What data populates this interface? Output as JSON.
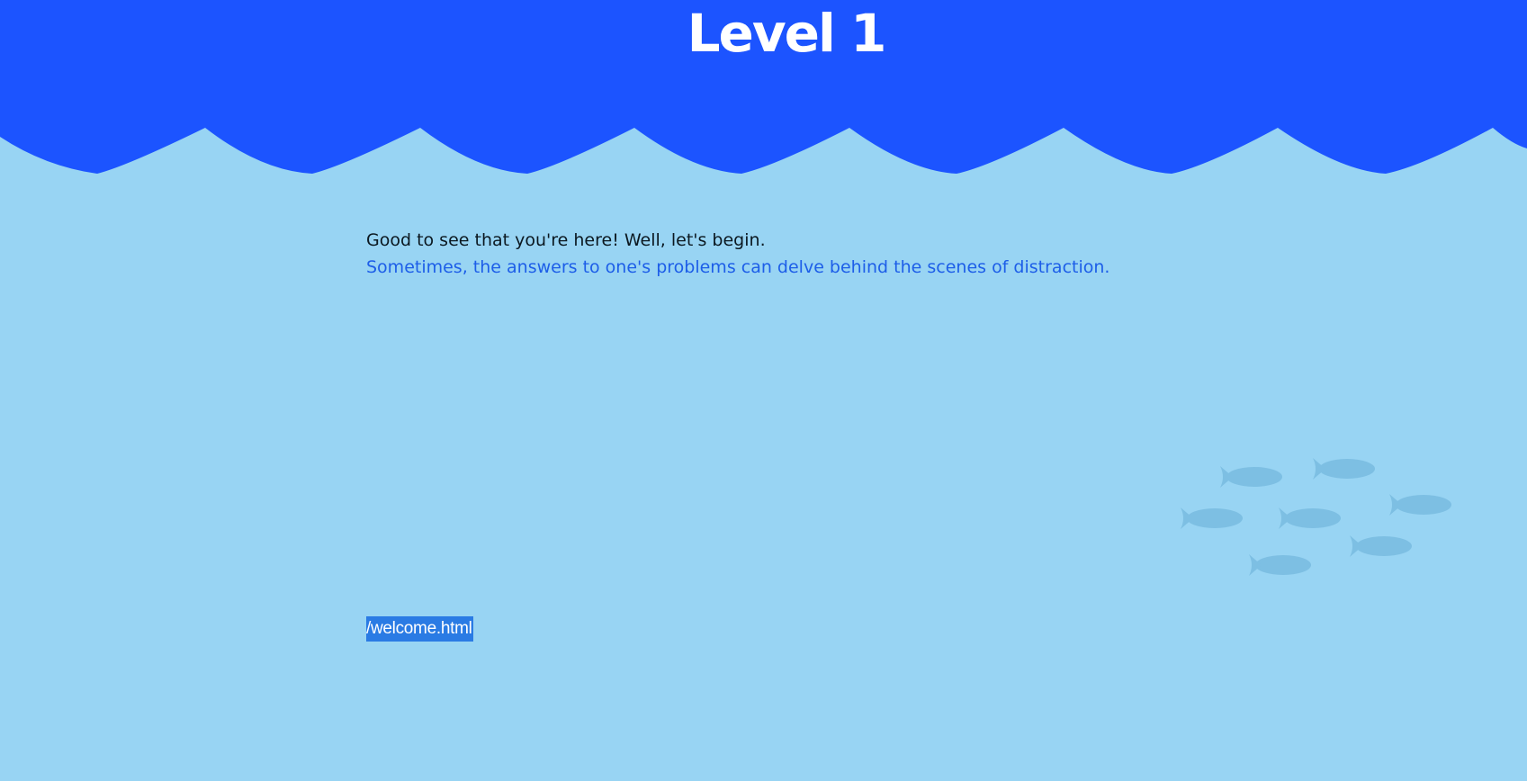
{
  "header": {
    "title": "Level 1"
  },
  "content": {
    "intro": "Good to see that you're here! Well, let's begin.",
    "hint": "Sometimes, the answers to one's problems can delve behind the scenes of distraction."
  },
  "selected_link": {
    "text": "/welcome.html"
  },
  "decor": {
    "icon": "fish-school-icon"
  },
  "colors": {
    "header_blue": "#1c54ff",
    "water": "#98d4f3",
    "hint_text": "#1d5ee8",
    "fish": "#7dbfe3",
    "selection": "#2a7be4"
  }
}
